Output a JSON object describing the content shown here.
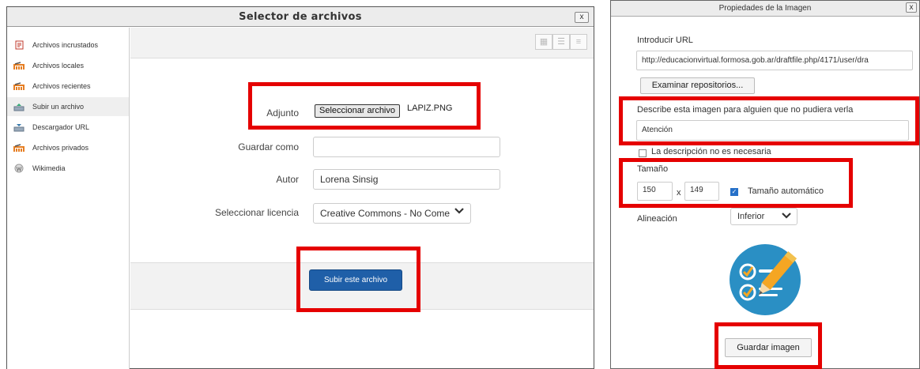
{
  "file_picker": {
    "title": "Selector de archivos",
    "close_label": "x",
    "sidebar": [
      {
        "label": "Archivos incrustados",
        "icon": "embedded-files-icon"
      },
      {
        "label": "Archivos locales",
        "icon": "moodle-repository-icon"
      },
      {
        "label": "Archivos recientes",
        "icon": "moodle-repository-icon"
      },
      {
        "label": "Subir un archivo",
        "icon": "upload-icon"
      },
      {
        "label": "Descargador URL",
        "icon": "url-download-icon"
      },
      {
        "label": "Archivos privados",
        "icon": "moodle-repository-icon"
      },
      {
        "label": "Wikimedia",
        "icon": "wikimedia-icon"
      }
    ],
    "form": {
      "attachment_label": "Adjunto",
      "choose_file_button": "Seleccionar archivo",
      "chosen_file": "LAPIZ.PNG",
      "save_as_label": "Guardar como",
      "save_as_value": "",
      "author_label": "Autor",
      "author_value": "Lorena Sinsig",
      "license_label": "Seleccionar licencia",
      "license_value": "Creative Commons - No Come"
    },
    "submit_button": "Subir este archivo"
  },
  "image_properties": {
    "title": "Propiedades de la Imagen",
    "close_label": "x",
    "url_label": "Introducir URL",
    "url_value": "http://educacionvirtual.formosa.gob.ar/draftfile.php/4171/user/dra",
    "browse_button": "Examinar repositorios...",
    "description_label": "Describe esta imagen para alguien que no pudiera verla",
    "description_value": "Atención",
    "description_not_needed_label": "La descripción no es necesaria",
    "size_label": "Tamaño",
    "width_value": "150",
    "size_separator": "x",
    "height_value": "149",
    "auto_size_label": "Tamaño automático",
    "alignment_label": "Alineación",
    "alignment_value": "Inferior",
    "save_button": "Guardar imagen"
  },
  "colors": {
    "highlight": "#e50000",
    "primary_button": "#1f5fa8",
    "preview_circle": "#2a8fc4",
    "preview_pencil": "#f5a623"
  }
}
